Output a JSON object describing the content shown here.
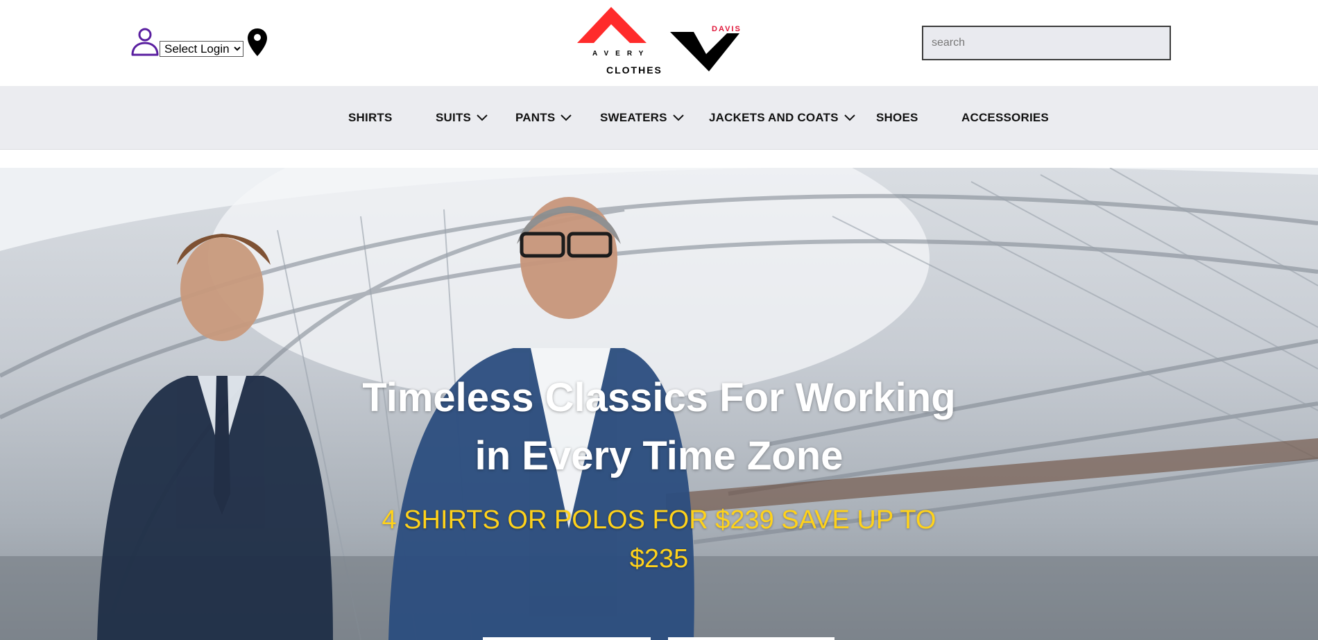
{
  "header": {
    "login_select": {
      "selected": "Select Login",
      "options": [
        "Select Login"
      ]
    },
    "search": {
      "placeholder": "search",
      "value": ""
    },
    "logo": {
      "brand_top": "DAVIS",
      "brand_mid": "AVERY",
      "brand_bottom": "CLOTHES"
    },
    "icons": {
      "user": "user-icon",
      "location": "location-pin-icon"
    },
    "colors": {
      "user_icon": "#5a1fa0",
      "logo_red": "#ff2b2b",
      "logo_davis": "#e0173a"
    }
  },
  "nav": {
    "items": [
      {
        "label": "SHIRTS",
        "has_dropdown": false
      },
      {
        "label": "SUITS",
        "has_dropdown": true
      },
      {
        "label": "PANTS",
        "has_dropdown": true
      },
      {
        "label": "SWEATERS",
        "has_dropdown": true
      },
      {
        "label": "JACKETS AND COATS",
        "has_dropdown": true
      },
      {
        "label": "SHOES",
        "has_dropdown": false
      },
      {
        "label": "ACCESSORIES",
        "has_dropdown": false
      }
    ]
  },
  "hero": {
    "title_line1": "Timeless Classics For Working",
    "title_line2": "in Every Time Zone",
    "subtitle_line1": "4 SHIRTS OR POLOS FOR $239 SAVE UP TO",
    "subtitle_line2": "$235",
    "colors": {
      "title": "#ffffff",
      "subtitle": "#ffd21a"
    }
  }
}
